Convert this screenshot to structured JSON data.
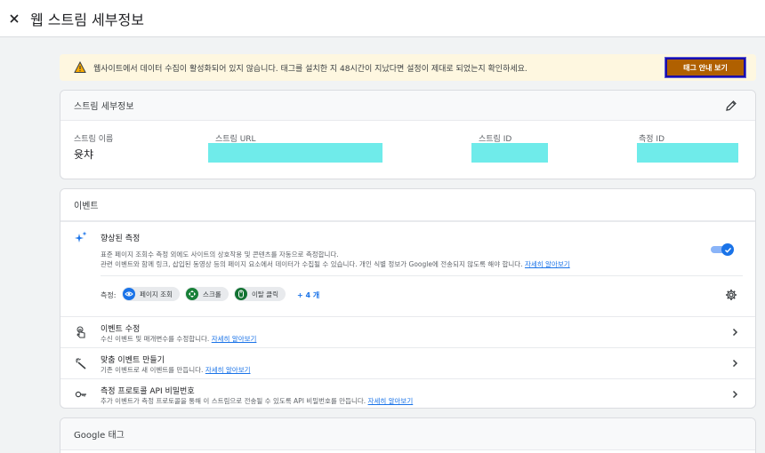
{
  "header": {
    "title": "웹 스트림 세부정보",
    "close_icon": "close-icon"
  },
  "banner": {
    "text": "웹사이트에서 데이터 수집이 활성화되어 있지 않습니다. 태그를 설치한 지 48시간이 지났다면 설정이 제대로 되었는지 확인하세요.",
    "button_label": "태그 안내 보기",
    "button_color": "#b06000"
  },
  "stream": {
    "section_title": "스트림 세부정보",
    "name_label": "스트림 이름",
    "name_value": "윳챠",
    "url_label": "스트림 URL",
    "id_label": "스트림 ID",
    "measurement_label": "측정 ID",
    "redaction_color": "#6febea"
  },
  "events": {
    "section_title": "이벤트",
    "enhanced": {
      "title": "향상된 측정",
      "desc1": "표준 페이지 조회수 측정 외에도 사이트의 상호작용 및 콘텐츠를 자동으로 측정합니다.",
      "desc2": "관련 이벤트와 함께 링크, 삽입된 동영상 등의 페이지 요소에서 데이터가 수집될 수 있습니다. 개인 식별 정보가 Google에 전송되지 않도록 해야 합니다.",
      "learn_more": "자세히 알아보기",
      "measure_label": "측정:",
      "chips": [
        {
          "label": "페이지 조회",
          "color": "#1a73e8"
        },
        {
          "label": "스크롤",
          "color": "#188038"
        },
        {
          "label": "이탈 클릭",
          "color": "#137333"
        }
      ],
      "more": "+ 4 개"
    },
    "modify": {
      "title": "이벤트 수정",
      "desc": "수신 이벤트 및 매개변수를 수정합니다.",
      "learn_more": "자세히 알아보기"
    },
    "create": {
      "title": "맞춤 이벤트 만들기",
      "desc": "기존 이벤트로 새 이벤트를 만듭니다.",
      "learn_more": "자세히 알아보기"
    },
    "api": {
      "title": "측정 프로토콜 API 비밀번호",
      "desc": "추가 이벤트가 측정 프로토콜을 통해 이 스트림으로 전송될 수 있도록 API 비밀번호를 만듭니다.",
      "learn_more": "자세히 알아보기"
    }
  },
  "google_tag": {
    "section_title": "Google 태그"
  }
}
